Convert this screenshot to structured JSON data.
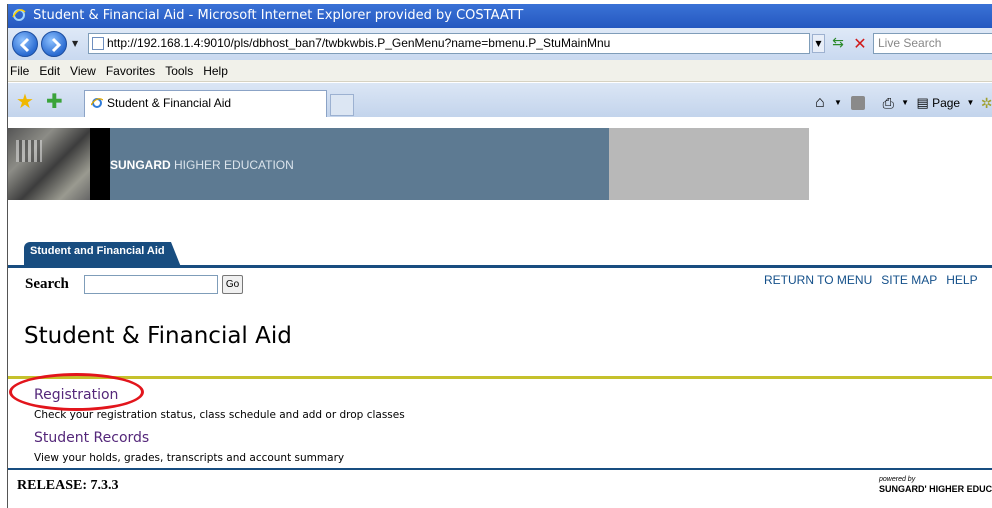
{
  "window": {
    "title": "Student & Financial Aid - Microsoft Internet Explorer provided by COSTAATT"
  },
  "address_bar": {
    "url": "http://192.168.1.4:9010/pls/dbhost_ban7/twbkwbis.P_GenMenu?name=bmenu.P_StuMainMnu",
    "search_placeholder": "Live Search"
  },
  "menu_bar": {
    "items": [
      "File",
      "Edit",
      "View",
      "Favorites",
      "Tools",
      "Help"
    ]
  },
  "tabs": {
    "active_tab": "Student & Financial Aid"
  },
  "command_bar": {
    "page_label": "Page"
  },
  "banner": {
    "brand": "SUNGARD",
    "brand_suffix": "HIGHER EDUCATION"
  },
  "nav": {
    "tab_label": "Student and Financial Aid",
    "search_label": "Search",
    "go_label": "Go",
    "links": [
      "RETURN TO MENU",
      "SITE MAP",
      "HELP"
    ]
  },
  "main": {
    "title": "Student & Financial Aid",
    "items": [
      {
        "label": "Registration",
        "description": "Check your registration status, class schedule and add or drop classes"
      },
      {
        "label": "Student Records",
        "description": "View your holds, grades, transcripts and account summary"
      }
    ]
  },
  "footer": {
    "release": "RELEASE: 7.3.3",
    "powered_by": "powered by",
    "powered_logo": "SUNGARD' HIGHER EDUCA"
  },
  "colors": {
    "nav_blue": "#184d80",
    "link_purple": "#54277a",
    "accent_gold": "#c5c12c",
    "annotation_red": "#e2151c"
  }
}
